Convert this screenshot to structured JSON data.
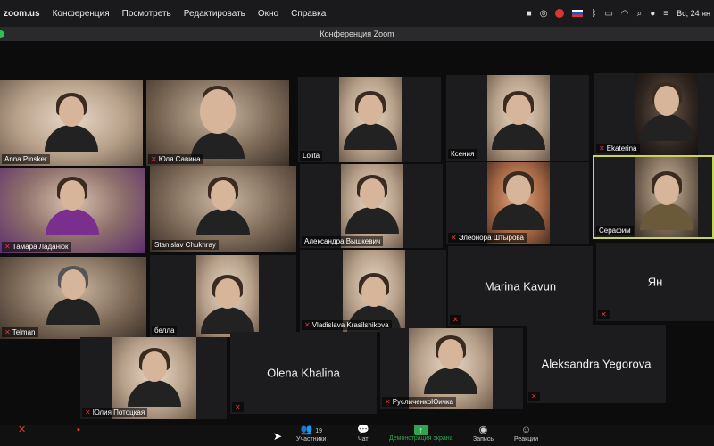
{
  "menubar": {
    "app": "zoom.us",
    "items": [
      "Конференция",
      "Посмотреть",
      "Редактировать",
      "Окно",
      "Справка"
    ],
    "clock": "Вс, 24 ян"
  },
  "window": {
    "title": "Конференция Zoom"
  },
  "tiles": [
    {
      "name": "Anna Pinsker",
      "muted": false
    },
    {
      "name": "Юля Савина",
      "muted": true
    },
    {
      "name": "Lolita",
      "muted": false
    },
    {
      "name": "Ксения",
      "muted": false
    },
    {
      "name": "Ekaterina",
      "muted": true
    },
    {
      "name": "Тамара Ладанюк",
      "muted": true
    },
    {
      "name": "Stanislav Chukhray",
      "muted": false
    },
    {
      "name": "Александра Вышкевич",
      "muted": false
    },
    {
      "name": "Элеонора Штырова",
      "muted": true
    },
    {
      "name": "Серафим",
      "muted": false
    },
    {
      "name": "Telman",
      "muted": true
    },
    {
      "name": "белла",
      "muted": false
    },
    {
      "name": "Vladislava Krasilshikova",
      "muted": true
    },
    {
      "name": "Marina Kavun",
      "muted": true
    },
    {
      "name": "Ян",
      "muted": true
    },
    {
      "name": "Юлия Потоцкая",
      "muted": true
    },
    {
      "name": "Olena Khalina",
      "muted": true
    },
    {
      "name": "РусличенкоЮичка",
      "muted": true
    },
    {
      "name": "Aleksandra Yegorova",
      "muted": true
    }
  ],
  "toolbar": {
    "participants_label": "Участники",
    "participants_count": "19",
    "chat_label": "Чат",
    "share_label": "Демонстрация экрана",
    "record_label": "Запись",
    "reactions_label": "Реакции"
  },
  "colors": {
    "share_green": "#2ea44f",
    "active_speaker": "#c9d45a",
    "muted_red": "#e0393e"
  }
}
